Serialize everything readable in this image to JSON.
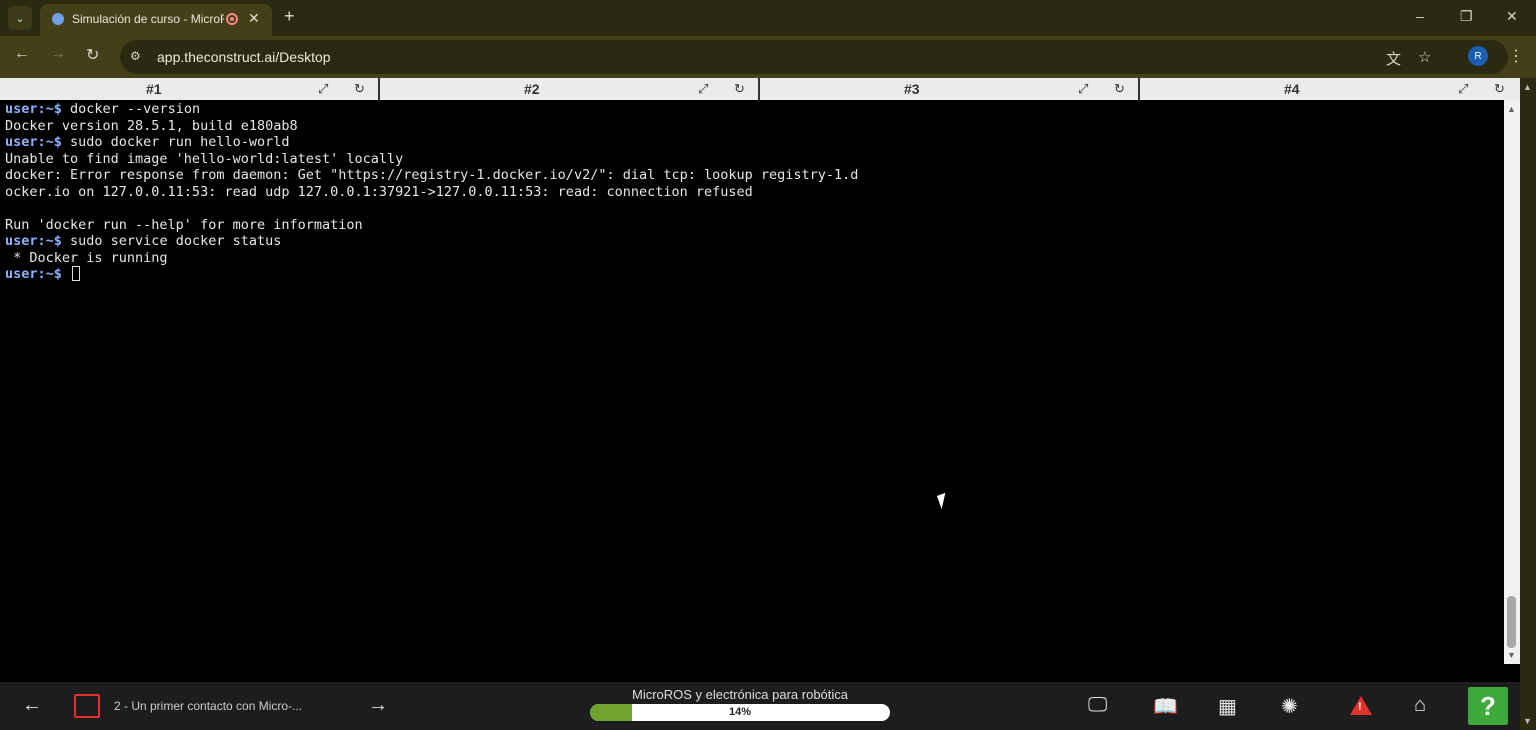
{
  "browser": {
    "tab_title": "Simulación de curso - MicroROS",
    "new_tab": "+",
    "url": "app.theconstruct.ai/Desktop",
    "profile_initial": "R",
    "window_controls": [
      "–",
      "❐",
      "✕"
    ],
    "icons": [
      "tab-search-icon",
      "favicon-icon",
      "recording-icon",
      "close-icon",
      "back-icon",
      "forward-icon",
      "reload-icon",
      "site-info-icon",
      "translate-icon",
      "bookmark-star-icon",
      "menu-kebab-icon"
    ]
  },
  "terminal_tabs": [
    {
      "label": "#1"
    },
    {
      "label": "#2"
    },
    {
      "label": "#3"
    },
    {
      "label": "#4"
    }
  ],
  "terminal": {
    "prompt": "user:~$",
    "lines": [
      {
        "prompt": "user:~$",
        "text": " docker --version"
      },
      {
        "prompt": "",
        "text": "Docker version 28.5.1, build e180ab8"
      },
      {
        "prompt": "user:~$",
        "text": " sudo docker run hello-world"
      },
      {
        "prompt": "",
        "text": "Unable to find image 'hello-world:latest' locally"
      },
      {
        "prompt": "",
        "text": "docker: Error response from daemon: Get \"https://registry-1.docker.io/v2/\": dial tcp: lookup registry-1.d"
      },
      {
        "prompt": "",
        "text": "ocker.io on 127.0.0.11:53: read udp 127.0.0.1:37921->127.0.0.11:53: read: connection refused"
      },
      {
        "prompt": "",
        "text": " "
      },
      {
        "prompt": "",
        "text": "Run 'docker run --help' for more information"
      },
      {
        "prompt": "user:~$",
        "text": " sudo service docker status"
      },
      {
        "prompt": "",
        "text": " * Docker is running"
      },
      {
        "prompt": "user:~$",
        "text": " "
      }
    ]
  },
  "course_bar": {
    "unit_label": "2 - Un primer contacto con Micro-...",
    "course_title": "MicroROS y electrónica para robótica",
    "progress_text": "14%",
    "progress_value": 0.14,
    "help_label": "?",
    "icons": [
      "back-arrow-icon",
      "forward-arrow-icon",
      "desktop-icon",
      "notebook-icon",
      "dashboard-icon",
      "ai-assistant-icon",
      "warning-icon",
      "home-icon",
      "help-icon"
    ]
  },
  "colors": {
    "chrome_dark": "#2b2910",
    "chrome_mid": "#433f19",
    "prompt": "#8fb2ff",
    "progress_fill": "#6fa22f",
    "help_green": "#3fa83b",
    "warning_red": "#e0312a"
  }
}
